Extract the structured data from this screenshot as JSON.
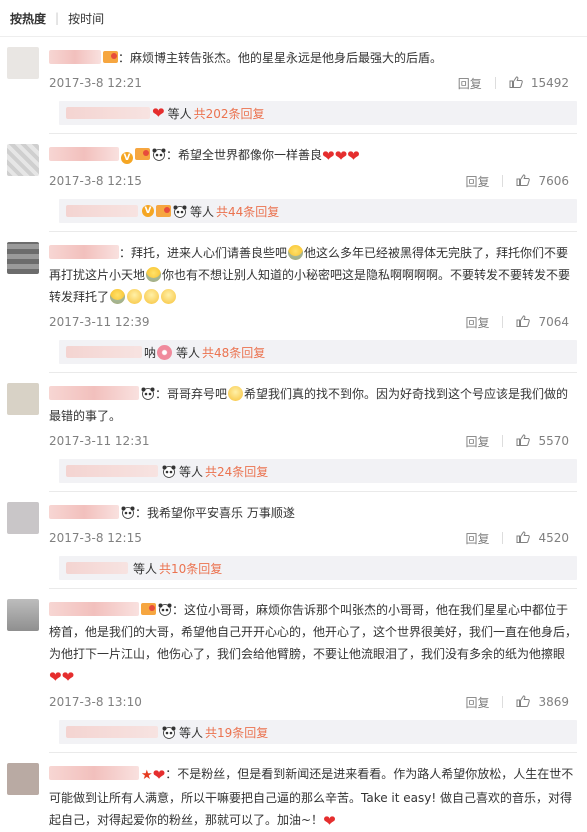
{
  "tabs": {
    "hot": "按热度",
    "sep": "|",
    "time": "按时间"
  },
  "reply_label": "回复",
  "replies_word": "等人",
  "comments": [
    {
      "text": "：麻烦博主转告张杰。他的星星永远是他身后最强大的后盾。",
      "time": "2017-3-8 12:21",
      "likes": "15492",
      "reply_count": "共202条回复"
    },
    {
      "text": "：希望全世界都像你一样善良",
      "time": "2017-3-8 12:15",
      "likes": "7606",
      "reply_count": "共44条回复"
    },
    {
      "text_a": "：拜托，进来人心们请善良些吧",
      "text_b": "他这么多年已经被黑得体无完肤了，拜托你们不要再打扰这片小天地",
      "text_c": "你也有不想让别人知道的小秘密吧这是隐私啊啊啊啊。不要转发不要转发不要转发拜托了",
      "time": "2017-3-11 12:39",
      "likes": "7064",
      "reply_count": "共48条回复",
      "reply_name_tail": "呐"
    },
    {
      "text_a": "：哥哥弃号吧",
      "text_b": "希望我们真的找不到你。因为好奇找到这个号应该是我们做的最错的事了。",
      "time": "2017-3-11 12:31",
      "likes": "5570",
      "reply_count": "共24条回复"
    },
    {
      "text": "：我希望你平安喜乐 万事顺遂",
      "time": "2017-3-8 12:15",
      "likes": "4520",
      "reply_count": "共10条回复"
    },
    {
      "text": "：这位小哥哥，麻烦你告诉那个叫张杰的小哥哥，他在我们星星心中都位于榜首，他是我们的大哥，希望他自己开开心心的，他开心了，这个世界很美好，我们一直在他身后，为他打下一片江山，他伤心了，我们会给他臂膀，不要让他流眼泪了，我们没有多余的纸为他擦眼",
      "time": "2017-3-8 13:10",
      "likes": "3869",
      "reply_count": "共19条回复"
    },
    {
      "text": "：不是粉丝，但是看到新闻还是进来看看。作为路人希望你放松，人生在世不可能做到让所有人满意，所以干嘛要把自己逼的那么辛苦。Take it easy! 做自己喜欢的音乐，对得起自己，对得起爱你的粉丝，那就可以了。加油~！"
    }
  ],
  "colors": {
    "link": "#eb7350",
    "meta": "#808080",
    "reply_bg": "#f2f2f5"
  }
}
